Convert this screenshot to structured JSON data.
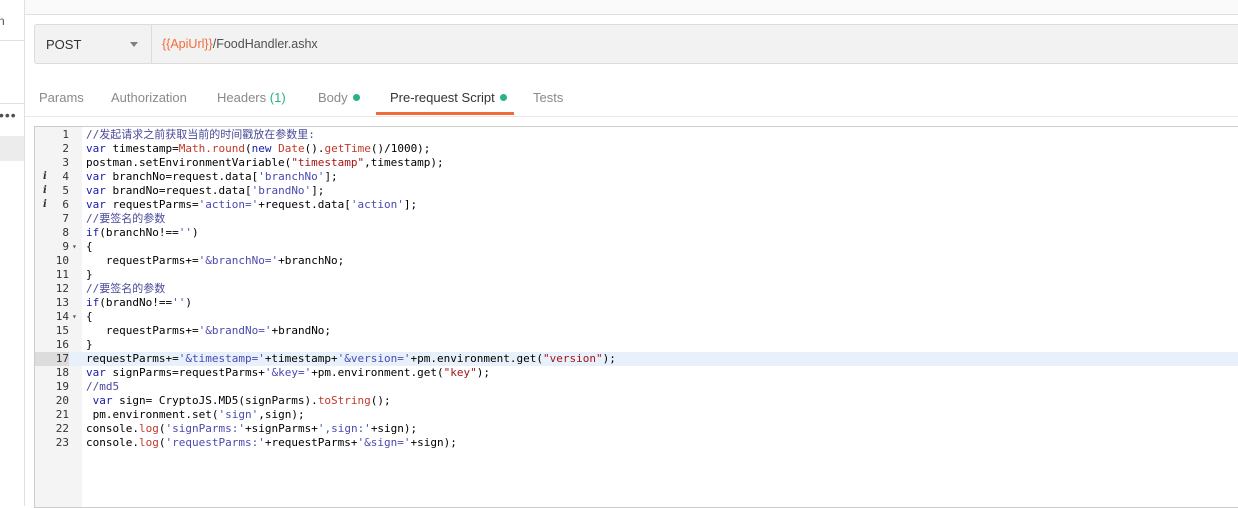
{
  "sidebar": {
    "fragment": "n",
    "menu_glyph": "•••"
  },
  "request": {
    "method": "POST",
    "url_variable": "{{ApiUrl}}",
    "url_path": "/FoodHandler.ashx"
  },
  "tabs": [
    {
      "label": "Params"
    },
    {
      "label": "Authorization"
    },
    {
      "label": "Headers",
      "count": "(1)"
    },
    {
      "label": "Body",
      "dot": true
    },
    {
      "label": "Pre-request Script",
      "dot": true,
      "active": true
    },
    {
      "label": "Tests"
    }
  ],
  "editor": {
    "highlighted_line": 17,
    "lines": [
      {
        "n": "1",
        "text": "//发起请求之前获取当前的时间戳放在参数里:"
      },
      {
        "n": "2",
        "text": "var timestamp=Math.round(new Date().getTime()/1000);"
      },
      {
        "n": "3",
        "text": "postman.setEnvironmentVariable(\"timestamp\",timestamp);"
      },
      {
        "n": "4",
        "text": "var branchNo=request.data['branchNo'];",
        "info": "i"
      },
      {
        "n": "5",
        "text": "var brandNo=request.data['brandNo'];",
        "info": "i"
      },
      {
        "n": "6",
        "text": "var requestParms='action='+request.data['action'];",
        "info": "i"
      },
      {
        "n": "7",
        "text": "//要签名的参数"
      },
      {
        "n": "8",
        "text": "if(branchNo!=='')"
      },
      {
        "n": "9",
        "text": "{",
        "fold": "▾"
      },
      {
        "n": "10",
        "text": "   requestParms+='&branchNo='+branchNo;"
      },
      {
        "n": "11",
        "text": "}"
      },
      {
        "n": "12",
        "text": "//要签名的参数"
      },
      {
        "n": "13",
        "text": "if(brandNo!=='')"
      },
      {
        "n": "14",
        "text": "{",
        "fold": "▾"
      },
      {
        "n": "15",
        "text": "   requestParms+='&brandNo='+brandNo;"
      },
      {
        "n": "16",
        "text": "}"
      },
      {
        "n": "17",
        "text": "requestParms+='&timestamp='+timestamp+'&version='+pm.environment.get(\"version\");"
      },
      {
        "n": "18",
        "text": "var signParms=requestParms+'&key='+pm.environment.get(\"key\");"
      },
      {
        "n": "19",
        "text": "//md5"
      },
      {
        "n": "20",
        "text": " var sign= CryptoJS.MD5(signParms).toString();"
      },
      {
        "n": "21",
        "text": " pm.environment.set('sign',sign);"
      },
      {
        "n": "22",
        "text": "console.log('signParms:'+signParms+',sign:'+sign);"
      },
      {
        "n": "23",
        "text": "console.log('requestParms:'+requestParms+'&sign='+sign);"
      }
    ]
  },
  "colors": {
    "accent": "#f26b3a",
    "status_dot": "#26b47f",
    "url_variable": "#f26b3a"
  }
}
